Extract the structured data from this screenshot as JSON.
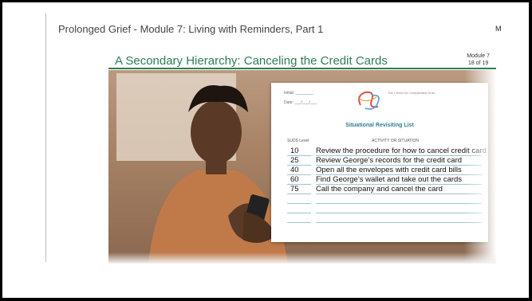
{
  "header": {
    "module_title": "Prolonged Grief - Module 7: Living with Reminders, Part 1",
    "corner_letter": "M"
  },
  "slide": {
    "title": "A Secondary Hierarchy: Canceling the Credit Cards",
    "module_label": "Module 7",
    "page_label": "18 of 19"
  },
  "document": {
    "initial_label": "Initial: ________",
    "date_label": "Date: ___/___/___",
    "logo_text": "The Center for Complicated Grief",
    "list_title": "Situational Revisiting List",
    "col_suds": "SUDS Level",
    "col_activity": "ACTIVITY OR SITUATION",
    "rows": [
      {
        "suds": "10",
        "activity": "Review the procedure for how to cancel credit card"
      },
      {
        "suds": "25",
        "activity": "Review George’s records for the credit card"
      },
      {
        "suds": "40",
        "activity": "Open all the envelopes with credit card bills"
      },
      {
        "suds": "60",
        "activity": "Find George’s wallet and take out the cards"
      },
      {
        "suds": "75",
        "activity": "Call the company and cancel the card"
      },
      {
        "suds": "",
        "activity": ""
      },
      {
        "suds": "",
        "activity": ""
      },
      {
        "suds": "",
        "activity": ""
      }
    ]
  },
  "colors": {
    "title_green": "#2e7d57",
    "list_blue": "#2e7d9f"
  }
}
